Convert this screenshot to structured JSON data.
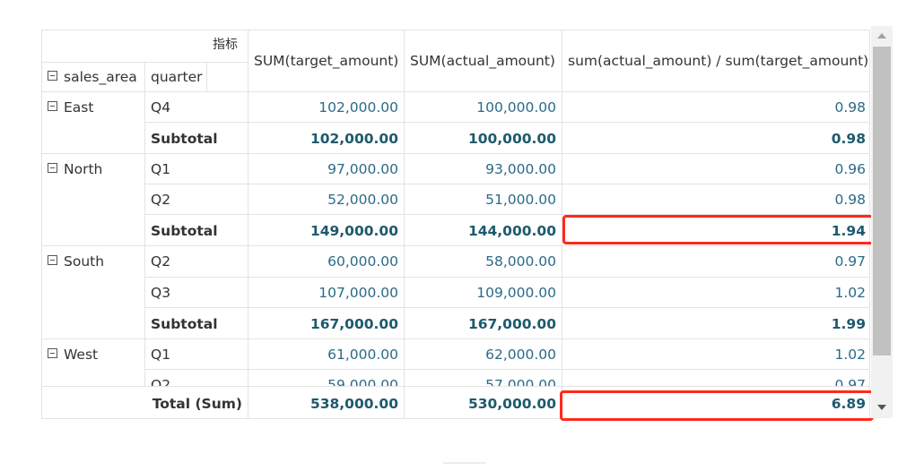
{
  "header": {
    "metric_label": "指标",
    "row_field_1": "sales_area",
    "row_field_2": "quarter",
    "col_1": "SUM(target_amount)",
    "col_2": "SUM(actual_amount)",
    "col_3": "sum(actual_amount) / sum(target_amount)"
  },
  "groups": [
    {
      "area": "East",
      "rows": [
        {
          "quarter": "Q4",
          "target": "102,000.00",
          "actual": "100,000.00",
          "ratio": "0.98"
        }
      ],
      "subtotal": {
        "label": "Subtotal",
        "target": "102,000.00",
        "actual": "100,000.00",
        "ratio": "0.98"
      }
    },
    {
      "area": "North",
      "rows": [
        {
          "quarter": "Q1",
          "target": "97,000.00",
          "actual": "93,000.00",
          "ratio": "0.96"
        },
        {
          "quarter": "Q2",
          "target": "52,000.00",
          "actual": "51,000.00",
          "ratio": "0.98"
        }
      ],
      "subtotal": {
        "label": "Subtotal",
        "target": "149,000.00",
        "actual": "144,000.00",
        "ratio": "1.94"
      }
    },
    {
      "area": "South",
      "rows": [
        {
          "quarter": "Q2",
          "target": "60,000.00",
          "actual": "58,000.00",
          "ratio": "0.97"
        },
        {
          "quarter": "Q3",
          "target": "107,000.00",
          "actual": "109,000.00",
          "ratio": "1.02"
        }
      ],
      "subtotal": {
        "label": "Subtotal",
        "target": "167,000.00",
        "actual": "167,000.00",
        "ratio": "1.99"
      }
    },
    {
      "area": "West",
      "rows": [
        {
          "quarter": "Q1",
          "target": "61,000.00",
          "actual": "62,000.00",
          "ratio": "1.02"
        },
        {
          "quarter": "Q2",
          "target": "59,000.00",
          "actual": "57,000.00",
          "ratio": "0.97"
        }
      ]
    }
  ],
  "total": {
    "label": "Total (Sum)",
    "target": "538,000.00",
    "actual": "530,000.00",
    "ratio": "6.89"
  },
  "colors": {
    "highlight": "#ff2a1a",
    "value": "#2b6a86",
    "value_bold": "#1e5a6e",
    "grid": "#e3e3e3"
  }
}
